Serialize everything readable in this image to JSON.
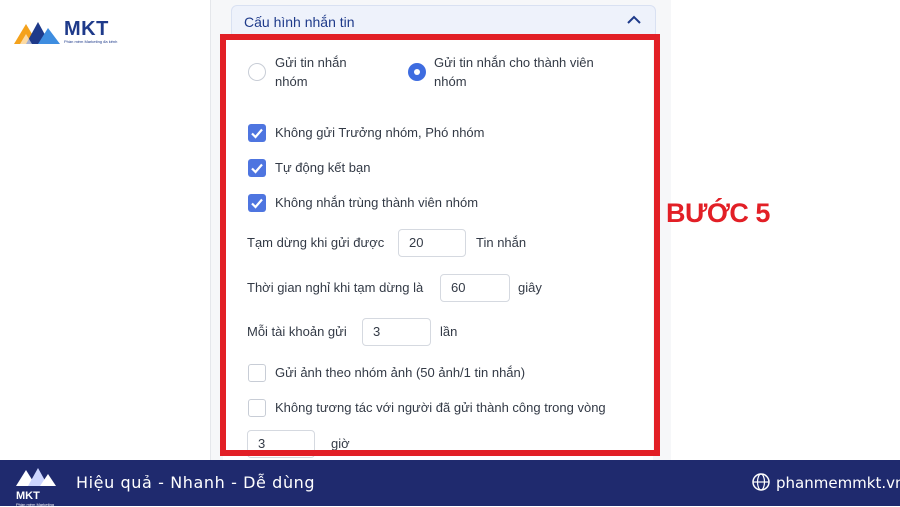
{
  "brand": {
    "name": "MKT",
    "subtitle": "Phần mềm Marketing đa kênh",
    "footer_name": "MKT",
    "footer_sub": "Phần mềm Marketing"
  },
  "section": {
    "title": "Cấu hình nhắn tin"
  },
  "send_mode": {
    "option1": "Gửi tin nhắn nhóm",
    "option2": "Gửi tin nhắn cho thành viên nhóm",
    "selected": "option2"
  },
  "options": {
    "skip_admins": "Không gửi Trưởng nhóm, Phó nhóm",
    "auto_friend": "Tự động kết bạn",
    "no_duplicate": "Không nhắn trùng thành viên nhóm",
    "send_images": "Gửi ảnh theo nhóm ảnh (50 ảnh/1 tin nhắn)",
    "no_interact": "Không tương tác với người đã gửi thành công trong vòng"
  },
  "pause": {
    "label": "Tạm dừng khi gửi được",
    "value": "20",
    "unit": "Tin nhắn"
  },
  "rest": {
    "label": "Thời gian nghỉ khi tạm dừng là",
    "value": "60",
    "unit": "giây"
  },
  "per_account": {
    "label": "Mỗi tài khoản gửi",
    "value": "3",
    "unit": "lần"
  },
  "hours": {
    "value": "3",
    "unit": "giờ"
  },
  "step_label": "BƯỚC 5",
  "footer": {
    "slogan": "Hiệu quả - Nhanh  - Dễ dùng",
    "website": "phanmemmkt.vn"
  },
  "colors": {
    "accent": "#3e6ce0",
    "frame": "#e21f26",
    "footer": "#1f2a6e",
    "brand": "#1e3a8a"
  }
}
